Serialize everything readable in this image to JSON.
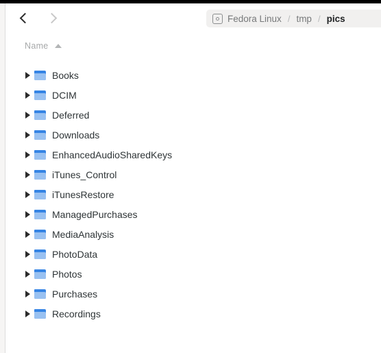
{
  "window": {
    "background": "#ffffff",
    "top_strip_color": "#000000"
  },
  "header": {
    "back_button": {
      "icon": "chevron-left-icon",
      "enabled": true
    },
    "forward_button": {
      "icon": "chevron-right-icon",
      "enabled": false
    },
    "breadcrumb": {
      "drive_icon": "drive-icon",
      "items": [
        {
          "label": "Fedora Linux",
          "current": false
        },
        {
          "label": "tmp",
          "current": false
        },
        {
          "label": "pics",
          "current": true
        }
      ],
      "separator": "/",
      "pill_background": "#f1f0ef"
    }
  },
  "columns": {
    "name": {
      "label": "Name",
      "sort": "ascending",
      "sort_icon": "sort-ascending-icon"
    }
  },
  "files": {
    "accent_folder_color": "#3584e4",
    "folder_front_color": "#99c1f1",
    "items": [
      {
        "name": "Books",
        "type": "folder",
        "expanded": false
      },
      {
        "name": "DCIM",
        "type": "folder",
        "expanded": false
      },
      {
        "name": "Deferred",
        "type": "folder",
        "expanded": false
      },
      {
        "name": "Downloads",
        "type": "folder",
        "expanded": false
      },
      {
        "name": "EnhancedAudioSharedKeys",
        "type": "folder",
        "expanded": false
      },
      {
        "name": "iTunes_Control",
        "type": "folder",
        "expanded": false
      },
      {
        "name": "iTunesRestore",
        "type": "folder",
        "expanded": false
      },
      {
        "name": "ManagedPurchases",
        "type": "folder",
        "expanded": false
      },
      {
        "name": "MediaAnalysis",
        "type": "folder",
        "expanded": false
      },
      {
        "name": "PhotoData",
        "type": "folder",
        "expanded": false
      },
      {
        "name": "Photos",
        "type": "folder",
        "expanded": false
      },
      {
        "name": "Purchases",
        "type": "folder",
        "expanded": false
      },
      {
        "name": "Recordings",
        "type": "folder",
        "expanded": false
      }
    ]
  }
}
